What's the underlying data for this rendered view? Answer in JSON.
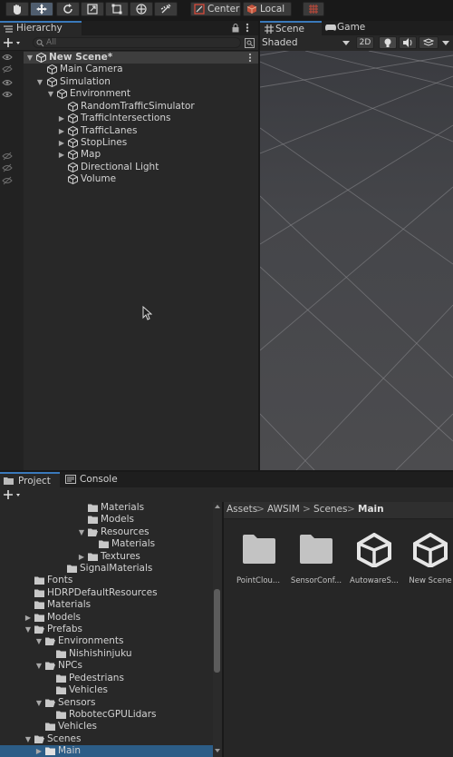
{
  "toolbar": {
    "tools": [
      "hand-tool-icon",
      "move-tool-icon",
      "rotate-tool-icon",
      "scale-tool-icon",
      "rect-tool-icon",
      "transform-tool-icon",
      "custom-tool-icon"
    ],
    "pivot_mode": "Center",
    "pivot_rotation": "Local",
    "grid_snap_icon": "grid-snap-icon"
  },
  "hierarchy": {
    "tab_label": "Hierarchy",
    "search_placeholder": "All",
    "rows": [
      {
        "label": "New Scene*"
      },
      {
        "label": "Main Camera"
      },
      {
        "label": "Simulation"
      },
      {
        "label": "Environment"
      },
      {
        "label": "RandomTrafficSimulator"
      },
      {
        "label": "TrafficIntersections"
      },
      {
        "label": "TrafficLanes"
      },
      {
        "label": "StopLines"
      },
      {
        "label": "Map"
      },
      {
        "label": "Directional Light"
      },
      {
        "label": "Volume"
      }
    ]
  },
  "scene": {
    "tabs": [
      "Scene",
      "Game"
    ],
    "shading_mode": "Shaded",
    "toggle_2d": "2D"
  },
  "project": {
    "tabs": [
      "Project",
      "Console"
    ],
    "tree": [
      {
        "label": "Materials"
      },
      {
        "label": "Models"
      },
      {
        "label": "Resources"
      },
      {
        "label": "Materials"
      },
      {
        "label": "Textures"
      },
      {
        "label": "SignalMaterials"
      },
      {
        "label": "Fonts"
      },
      {
        "label": "HDRPDefaultResources"
      },
      {
        "label": "Materials"
      },
      {
        "label": "Models"
      },
      {
        "label": "Prefabs"
      },
      {
        "label": "Environments"
      },
      {
        "label": "Nishishinjuku"
      },
      {
        "label": "NPCs"
      },
      {
        "label": "Pedestrians"
      },
      {
        "label": "Vehicles"
      },
      {
        "label": "Sensors"
      },
      {
        "label": "RobotecGPULidars"
      },
      {
        "label": "Vehicles"
      },
      {
        "label": "Scenes"
      },
      {
        "label": "Main"
      }
    ],
    "breadcrumb": [
      "Assets",
      "AWSIM",
      "Scenes",
      "Main"
    ],
    "assets": [
      {
        "label": "PointClou...",
        "icon": "folder-icon"
      },
      {
        "label": "SensorConf...",
        "icon": "folder-icon"
      },
      {
        "label": "AutowareS...",
        "icon": "unity-scene-icon"
      },
      {
        "label": "New Scene",
        "icon": "unity-scene-icon"
      }
    ]
  },
  "colors": {
    "accent_tab": "#3a79bb",
    "selection": "#2c5d87",
    "panel": "#282828"
  }
}
